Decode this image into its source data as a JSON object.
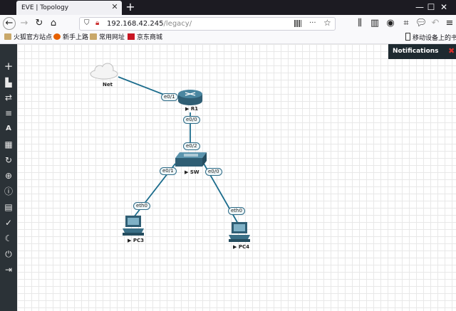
{
  "browser": {
    "tab_title": "EVE | Topology",
    "tab_close": "✕",
    "new_tab": "+",
    "url_host": "192.168.42.245",
    "url_path": "/legacy/",
    "more_dots": "···",
    "bookmarks": [
      {
        "label": "火狐官方站点"
      },
      {
        "label": "新手上路"
      },
      {
        "label": "常用网址"
      },
      {
        "label": "京东商城"
      },
      {
        "label": "移动设备上的书签"
      }
    ]
  },
  "notifications": {
    "title": "Notifications",
    "close": "✖"
  },
  "topology": {
    "nodes": {
      "net": "Net",
      "r1": "▶ R1",
      "sw": "▶ SW",
      "pc3": "▶ PC3",
      "pc4": "▶ PC4"
    },
    "ports": {
      "r1_e01": "e0/1",
      "r1_e00": "e0/0",
      "sw_e02": "e0/2",
      "sw_e01": "e0/1",
      "sw_e00": "e0/0",
      "pc3_eth0": "eth0",
      "pc4_eth0": "eth0"
    }
  },
  "colors": {
    "link": "#1b6c8c",
    "device": "#3a6f86",
    "sidebar": "#2b3237"
  }
}
